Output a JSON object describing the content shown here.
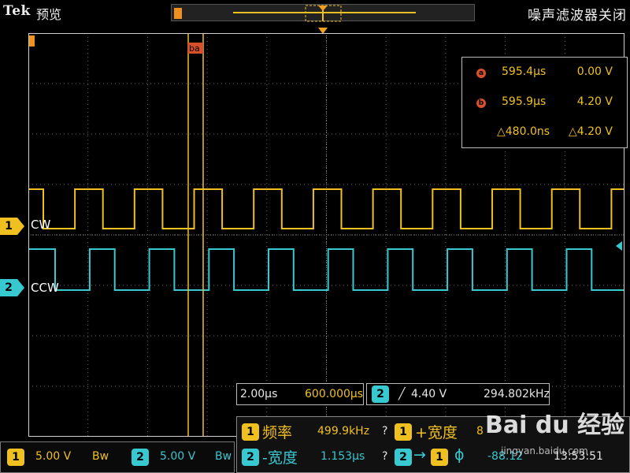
{
  "header": {
    "brand": "Tek",
    "mode": "预览",
    "filter_status": "噪声滤波器关闭"
  },
  "markers": {
    "trigger_position": "T",
    "cursor_b_tag": "ba"
  },
  "cursors": {
    "rows": [
      {
        "badge": "a",
        "time": "595.4µs",
        "volt": "0.00 V"
      },
      {
        "badge": "b",
        "time": "595.9µs",
        "volt": "4.20 V"
      },
      {
        "badge": "",
        "time": "△480.0ns",
        "volt": "△4.20 V"
      }
    ]
  },
  "channels": [
    {
      "id": "1",
      "label": "CW",
      "color": "#f0c020"
    },
    {
      "id": "2",
      "label": "CCW",
      "color": "#38c8d0"
    }
  ],
  "timebase": {
    "scale": "2.00µs",
    "position": "600.000µs"
  },
  "trigger": {
    "channel": "2",
    "slope": "╱",
    "level": "4.40 V",
    "freq": "294.802kHz"
  },
  "measurements": {
    "row1": {
      "ch": "1",
      "name": "频率",
      "value": "499.9kHz",
      "q": "?",
      "ch2": "1",
      "name2": "+宽度",
      "value2": "8"
    },
    "row2": {
      "ch": "2",
      "name": "-宽度",
      "value": "1.153µs",
      "q": "?",
      "ch2": "2",
      "arrow": "→",
      "ch3": "1",
      "name2": "ϕ",
      "value2": "-88.12",
      "time": "13:53:51"
    }
  },
  "status": {
    "ch1": {
      "id": "1",
      "volts": "5.00 V",
      "bw": "Bw"
    },
    "ch2": {
      "id": "2",
      "volts": "5.00 V",
      "bw": "Bw"
    }
  },
  "watermark": {
    "text": "Bai du 经验",
    "url": "jingyan.baidu.com"
  },
  "colors": {
    "ch1": "#f0c020",
    "ch2": "#38c8d0",
    "cursor": "#f0c020",
    "grid": "#6a6a6a"
  }
}
